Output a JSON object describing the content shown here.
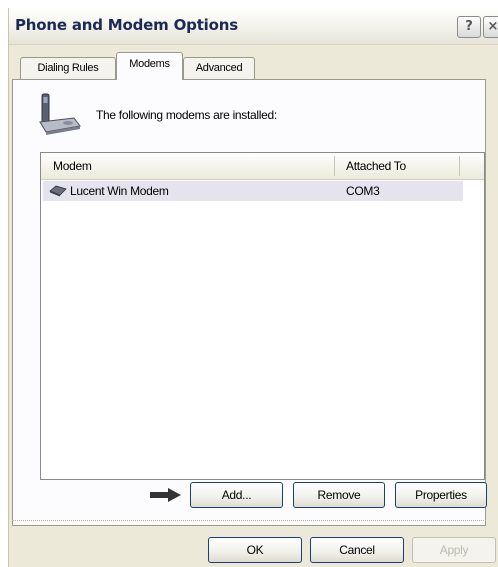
{
  "window": {
    "title": "Phone and Modem Options"
  },
  "titlebar": {
    "help_glyph": "?",
    "close_glyph": "×"
  },
  "tabs": [
    {
      "label": "Dialing Rules",
      "active": false
    },
    {
      "label": "Modems",
      "active": true
    },
    {
      "label": "Advanced",
      "active": false
    }
  ],
  "intro_text": "The following modems are installed:",
  "list": {
    "columns": [
      "Modem",
      "Attached To"
    ],
    "rows": [
      {
        "modem": "Lucent Win Modem",
        "attached_to": "COM3",
        "selected": true
      }
    ]
  },
  "buttons": {
    "add": "Add...",
    "remove": "Remove",
    "properties": "Properties",
    "ok": "OK",
    "cancel": "Cancel",
    "apply": "Apply"
  },
  "colors": {
    "title_text": "#1b2a55",
    "selection": "#e4e3ee",
    "button_border": "#1c3d7a"
  },
  "icons": [
    "phone-modem-icon",
    "modem-icon",
    "pointer-arrow-icon",
    "help-icon",
    "close-icon"
  ]
}
